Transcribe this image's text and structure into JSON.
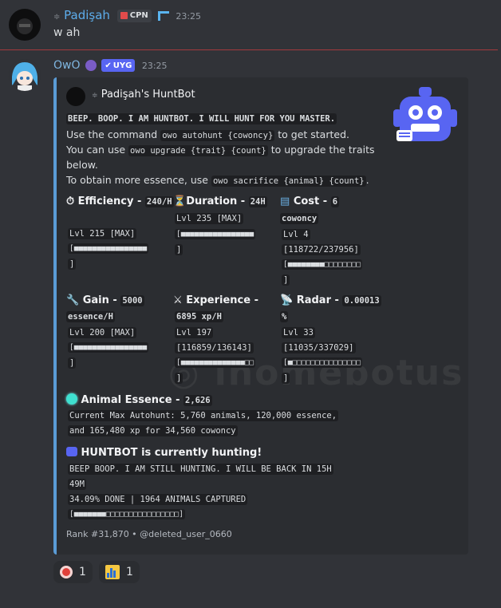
{
  "msg1": {
    "author": "Padişah",
    "tag": "CPN",
    "time": "23:25",
    "text": "w ah"
  },
  "msg2": {
    "author": "OwO",
    "tag": "UYG",
    "time": "23:25"
  },
  "embed": {
    "author": "Padişah's HuntBot",
    "intro": "BEEP. BOOP. I AM HUNTBOT. I WILL HUNT FOR YOU MASTER.",
    "line1a": "Use the command ",
    "line1code": "owo autohunt {cowoncy}",
    "line1b": " to get started.",
    "line2a": "You can use ",
    "line2code": "owo upgrade {trait} {count}",
    "line2b": " to upgrade the traits",
    "line3": "below.",
    "line4a": "To obtain more essence, use ",
    "line4code": "owo sacrifice {animal} {count}",
    "line4b": ".",
    "fields": {
      "efficiency": {
        "label": "Efficiency - ",
        "value": "240/H",
        "lvl": "Lvl 215 [MAX]",
        "bar": "[■■■■■■■■■■■■■■■■",
        "close": "]"
      },
      "duration": {
        "label": "Duration - ",
        "value": "24H",
        "lvl": "Lvl 235 [MAX]",
        "bar": "[■■■■■■■■■■■■■■■■",
        "close": "]"
      },
      "cost": {
        "label": "Cost - ",
        "value": "6",
        "value2": "cowoncy",
        "lvl": "Lvl 4",
        "prog": "[118722/237956]",
        "bar": "[■■■■■■■■□□□□□□□□",
        "close": "]"
      },
      "gain": {
        "label": "Gain - ",
        "value": "5000",
        "value2": "essence/H",
        "lvl": "Lvl 200 [MAX]",
        "bar": "[■■■■■■■■■■■■■■■■",
        "close": "]"
      },
      "experience": {
        "label": "Experience - ",
        "value": "6895 xp/H",
        "lvl": "Lvl 197",
        "prog": "[116859/136143]",
        "bar": "[■■■■■■■■■■■■■■□□",
        "close": "]"
      },
      "radar": {
        "label": "Radar - ",
        "value": "0.00013",
        "value2": "%",
        "lvl": "Lvl 33",
        "prog": "[11035/337029]",
        "bar": "[■□□□□□□□□□□□□□□□",
        "close": "]"
      }
    },
    "essence": {
      "label": "Animal Essence - ",
      "value": "2,626",
      "l1": "Current Max Autohunt: 5,760 animals, 120,000 essence,",
      "l2": "and 165,480 xp for 34,560 cowoncy"
    },
    "hunting": {
      "title": "HUNTBOT is currently hunting!",
      "l1": "BEEP BOOP. I AM STILL HUNTING. I WILL BE BACK IN 15H",
      "l2": "49M",
      "l3": "34.09% DONE | 1964 ANIMALS CAPTURED",
      "l4": "[■■■■■■■□□□□□□□□□□□□□□□□]"
    },
    "footer": "Rank #31,870 • @deleted_user_0660"
  },
  "reactions": [
    {
      "icon": "alarm-clock-icon",
      "count": "1"
    },
    {
      "icon": "bar-chart-icon",
      "count": "1"
    }
  ],
  "colors": {
    "accent": "#5a9bd5",
    "name1": "#5dadec",
    "name2": "#7fb6e0",
    "badge": "#5865f2"
  }
}
